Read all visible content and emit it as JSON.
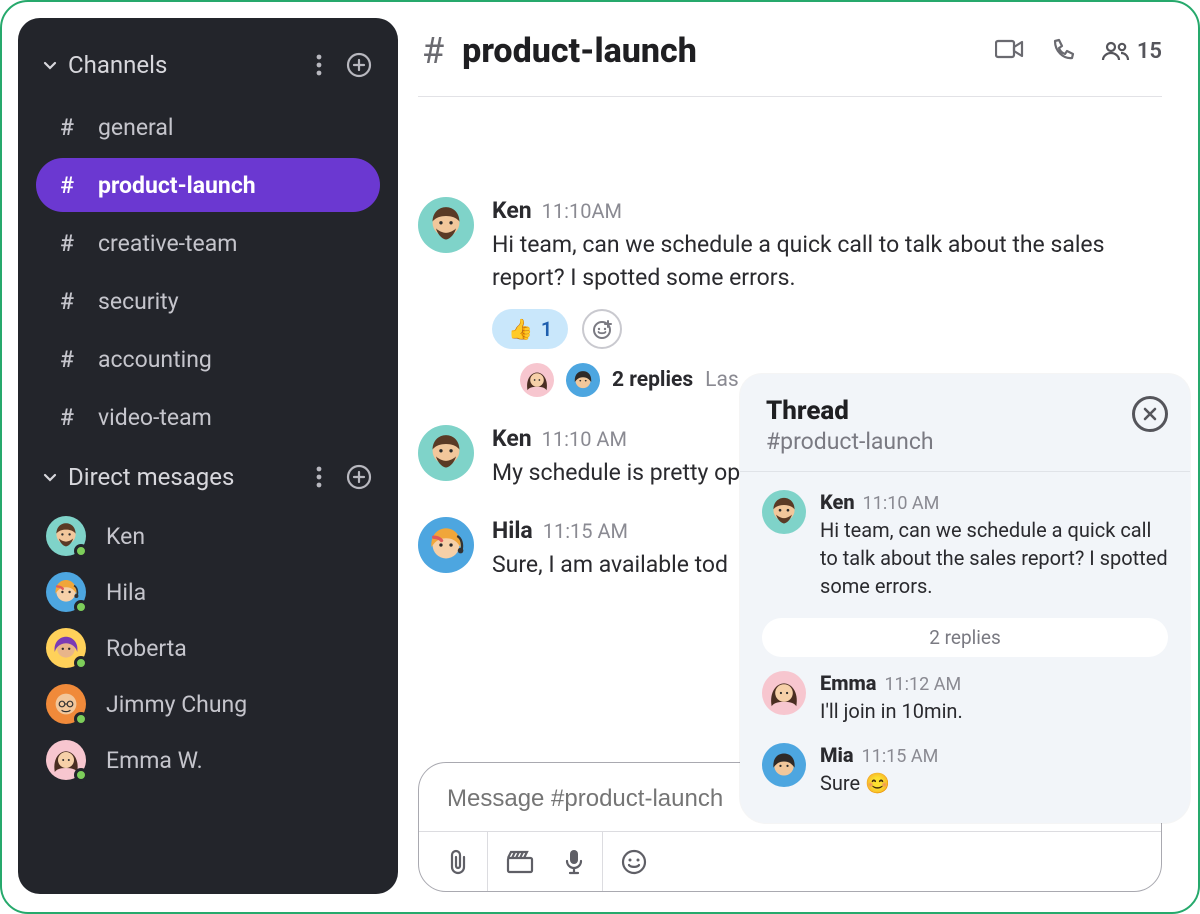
{
  "sidebar": {
    "channels_label": "Channels",
    "dm_label": "Direct mesages",
    "channels": [
      {
        "name": "general",
        "active": false
      },
      {
        "name": "product-launch",
        "active": true
      },
      {
        "name": "creative-team",
        "active": false
      },
      {
        "name": "security",
        "active": false
      },
      {
        "name": "accounting",
        "active": false
      },
      {
        "name": "video-team",
        "active": false
      }
    ],
    "dms": [
      {
        "name": "Ken",
        "avatar": "ken"
      },
      {
        "name": "Hila",
        "avatar": "hila"
      },
      {
        "name": "Roberta",
        "avatar": "roberta"
      },
      {
        "name": "Jimmy Chung",
        "avatar": "jimmy"
      },
      {
        "name": "Emma W.",
        "avatar": "emma"
      }
    ]
  },
  "header": {
    "channel_title": "product-launch",
    "member_count": "15"
  },
  "messages": [
    {
      "author": "Ken",
      "time": "11:10AM",
      "text": "Hi team, can we schedule a quick call to talk about the sales report? I spotted some errors.",
      "avatar": "ken",
      "reaction_emoji": "👍",
      "reaction_count": "1",
      "thread_replies_label": "2 replies",
      "thread_last_label": "Las",
      "thread_avatars": [
        "emma",
        "mia"
      ]
    },
    {
      "author": "Ken",
      "time": "11:10 AM",
      "text": "My schedule is pretty op",
      "avatar": "ken"
    },
    {
      "author": "Hila",
      "time": "11:15 AM",
      "text": "Sure, I am available tod",
      "avatar": "hila"
    }
  ],
  "composer": {
    "placeholder": "Message #product-launch"
  },
  "thread": {
    "title": "Thread",
    "subtitle": "#product-launch",
    "root": {
      "author": "Ken",
      "time": "11:10 AM",
      "text": "Hi team, can we schedule a quick call to talk about the sales report? I spotted some errors.",
      "avatar": "ken"
    },
    "replies_divider": "2 replies",
    "replies": [
      {
        "author": "Emma",
        "time": "11:12 AM",
        "text": "I'll join in 10min.",
        "avatar": "emma"
      },
      {
        "author": "Mia",
        "time": "11:15 AM",
        "text": "Sure 😊",
        "avatar": "mia"
      }
    ]
  }
}
